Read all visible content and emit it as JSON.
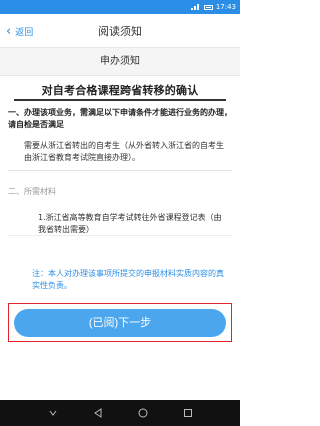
{
  "status": {
    "time": "17:43"
  },
  "nav": {
    "back_label": "返回",
    "title": "阅读须知"
  },
  "sub_header": "申办须知",
  "doc": {
    "title": "对自考合格课程跨省转移的确认",
    "req_heading": "一、办理该项业务，需满足以下申请条件才能进行业务的办理，请自检是否满足",
    "req_body": "需要从浙江省转出的自考生（从外省转入浙江省的自考生由浙江省教育考试院直接办理）。",
    "mat_heading": "二、所需材料",
    "mat_item": "1.浙江省高等教育自学考试转往外省课程登记表（由我省转出需要）",
    "note": "注：本人对办理该事项所提交的申报材料实质内容的真实性负责。"
  },
  "next_button_label": "(已阅)下一步",
  "colors": {
    "accent": "#2b8ee6",
    "button": "#4ca6ee",
    "highlight": "#e0242a"
  },
  "icons": [
    "back-chevron-icon",
    "signal-icon",
    "battery-icon",
    "back-key-icon",
    "home-key-icon",
    "recent-key-icon",
    "menu-key-icon"
  ]
}
